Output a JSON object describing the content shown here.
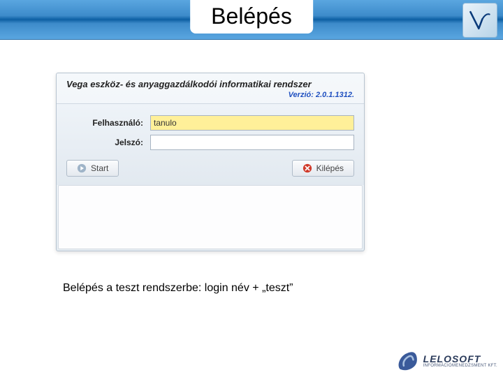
{
  "header": {
    "title": "Belépés"
  },
  "dialog": {
    "title": "Vega eszköz- és anyaggazdálkodói informatikai rendszer",
    "version_label": "Verzió: 2.0.1.1312.",
    "fields": {
      "user_label": "Felhasználó:",
      "user_value": "tanulo",
      "pass_label": "Jelszó:",
      "pass_value": ""
    },
    "buttons": {
      "start": "Start",
      "exit": "Kilépés"
    }
  },
  "caption": "Belépés a teszt rendszerbe: login név + „teszt”",
  "footer": {
    "brand": "LELOSOFT",
    "tagline": "INFORMÁCIÓMENEDZSMENT KFT."
  }
}
